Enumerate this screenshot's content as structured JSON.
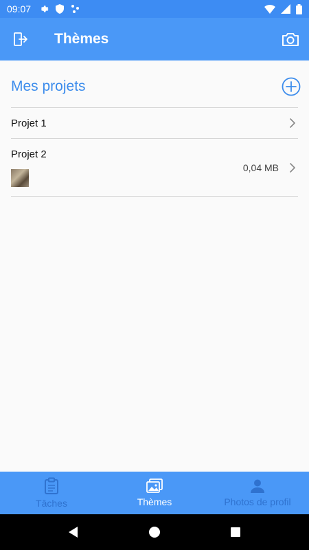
{
  "status_bar": {
    "time": "09:07"
  },
  "app_bar": {
    "title": "Thèmes"
  },
  "section": {
    "title": "Mes projets"
  },
  "projects": [
    {
      "name": "Projet 1",
      "size": ""
    },
    {
      "name": "Projet 2",
      "size": "0,04 MB"
    }
  ],
  "bottom_nav": {
    "items": [
      {
        "label": "Tâches",
        "icon": "clipboard-icon",
        "active": false
      },
      {
        "label": "Thèmes",
        "icon": "gallery-icon",
        "active": true
      },
      {
        "label": "Photos de profil",
        "icon": "person-icon",
        "active": false
      }
    ]
  },
  "colors": {
    "primary": "#4a98f7",
    "status_bar": "#3d8cf3",
    "accent_text": "#3c8cec",
    "inactive_nav": "#2f72cf"
  }
}
